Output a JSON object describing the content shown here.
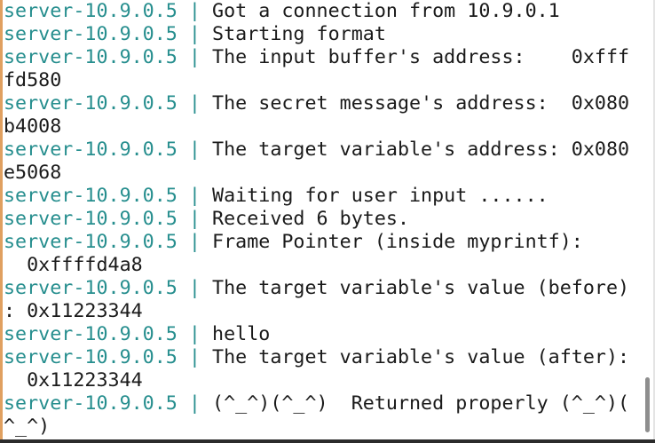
{
  "colors": {
    "prefix": "#268e8e",
    "text": "#1a1a1a",
    "background": "#ffffff"
  },
  "terminal": {
    "lines": [
      {
        "prefix": "server-10.9.0.5 | ",
        "text": "Got a connection from 10.9.0.1"
      },
      {
        "prefix": "server-10.9.0.5 | ",
        "text": "Starting format"
      },
      {
        "prefix": "server-10.9.0.5 | ",
        "text": "The input buffer's address:    0xfff"
      },
      {
        "prefix": "",
        "text": "fd580"
      },
      {
        "prefix": "server-10.9.0.5 | ",
        "text": "The secret message's address:  0x080"
      },
      {
        "prefix": "",
        "text": "b4008"
      },
      {
        "prefix": "server-10.9.0.5 | ",
        "text": "The target variable's address: 0x080"
      },
      {
        "prefix": "",
        "text": "e5068"
      },
      {
        "prefix": "server-10.9.0.5 | ",
        "text": "Waiting for user input ......"
      },
      {
        "prefix": "server-10.9.0.5 | ",
        "text": "Received 6 bytes."
      },
      {
        "prefix": "server-10.9.0.5 | ",
        "text": "Frame Pointer (inside myprintf):"
      },
      {
        "prefix": "",
        "text": "  0xffffd4a8"
      },
      {
        "prefix": "server-10.9.0.5 | ",
        "text": "The target variable's value (before)"
      },
      {
        "prefix": "",
        "text": ": 0x11223344"
      },
      {
        "prefix": "server-10.9.0.5 | ",
        "text": "hello"
      },
      {
        "prefix": "server-10.9.0.5 | ",
        "text": "The target variable's value (after):"
      },
      {
        "prefix": "",
        "text": "  0x11223344"
      },
      {
        "prefix": "server-10.9.0.5 | ",
        "text": "(^_^)(^_^)  Returned properly (^_^)("
      },
      {
        "prefix": "",
        "text": "^_^)"
      }
    ]
  }
}
